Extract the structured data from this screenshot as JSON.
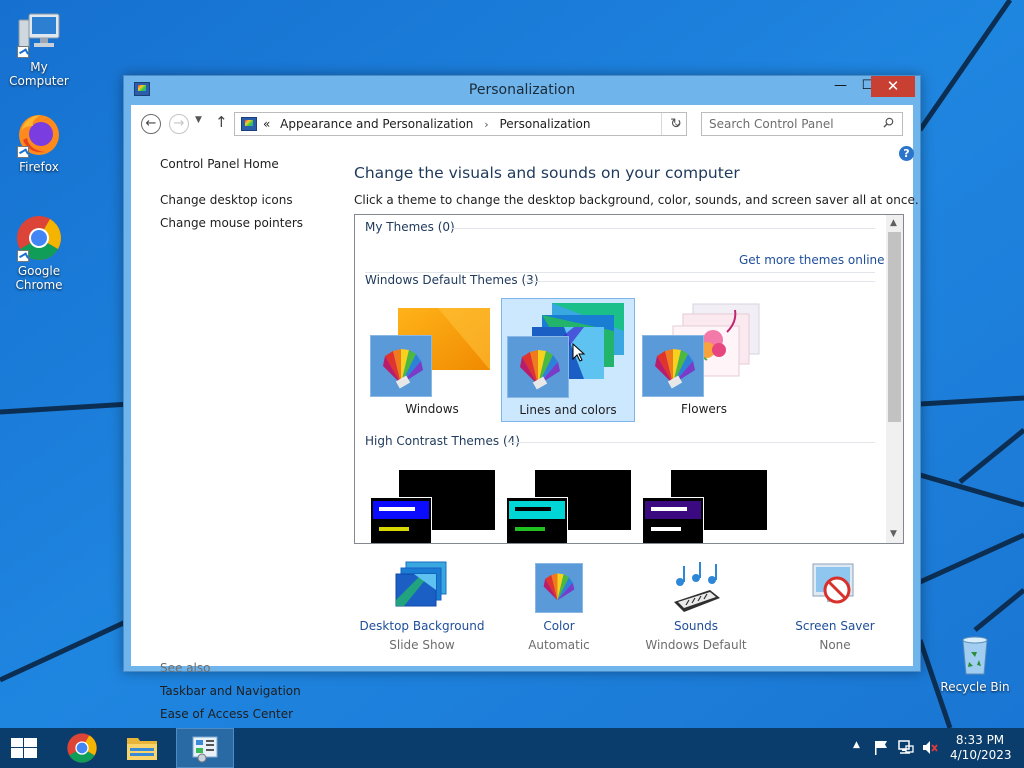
{
  "desktop": {
    "icons": [
      {
        "label": "My Computer",
        "icon": "computer-icon"
      },
      {
        "label": "Firefox",
        "icon": "firefox-icon"
      },
      {
        "label": "Google Chrome",
        "icon": "chrome-icon"
      },
      {
        "label": "Recycle Bin",
        "icon": "recycle-bin-icon"
      }
    ]
  },
  "window": {
    "title": "Personalization",
    "controls": {
      "minimize": "—",
      "maximize": "☐",
      "close": "✕"
    }
  },
  "address_bar": {
    "overflow": "«",
    "crumbs": [
      "Appearance and Personalization",
      "Personalization"
    ],
    "separator": "›"
  },
  "search": {
    "placeholder": "Search Control Panel"
  },
  "help": {
    "label": "?"
  },
  "left_pane": {
    "home": "Control Panel Home",
    "links": [
      "Change desktop icons",
      "Change mouse pointers"
    ],
    "see_also_label": "See also",
    "see_also": [
      "Taskbar and Navigation",
      "Ease of Access Center"
    ]
  },
  "main": {
    "heading": "Change the visuals and sounds on your computer",
    "subtext": "Click a theme to change the desktop background, color, sounds, and screen saver all at once."
  },
  "themes": {
    "my_themes_label": "My Themes (0)",
    "get_more_link": "Get more themes online",
    "default_label": "Windows Default Themes (3)",
    "default_items": [
      {
        "name": "Windows",
        "selected": false
      },
      {
        "name": "Lines and colors",
        "selected": true
      },
      {
        "name": "Flowers",
        "selected": false
      }
    ],
    "high_contrast_label": "High Contrast Themes (4)",
    "hc_colors": [
      {
        "bar": "#0b0bff",
        "line1": "#ffffff",
        "line2": "#d8d800"
      },
      {
        "bar": "#00d6d6",
        "line1": "#000000",
        "line2": "#20c020"
      },
      {
        "bar": "#3c0a80",
        "line1": "#ffffff",
        "line2": "#ffffff"
      }
    ]
  },
  "settings": [
    {
      "name": "Desktop Background",
      "value": "Slide Show",
      "icon": "desktop-background-icon"
    },
    {
      "name": "Color",
      "value": "Automatic",
      "icon": "color-palette-icon"
    },
    {
      "name": "Sounds",
      "value": "Windows Default",
      "icon": "sounds-icon"
    },
    {
      "name": "Screen Saver",
      "value": "None",
      "icon": "screen-saver-icon"
    }
  ],
  "taskbar": {
    "clock_time": "8:33 PM",
    "clock_date": "4/10/2023"
  },
  "colors": {
    "desktop_bg": "#1d7fd8",
    "window_frame": "#6fb4ea",
    "close_button": "#c84031",
    "link": "#1e4e9a",
    "heading": "#1e395b",
    "taskbar": "#0a3d6b",
    "selected_theme": "#cce8ff"
  }
}
